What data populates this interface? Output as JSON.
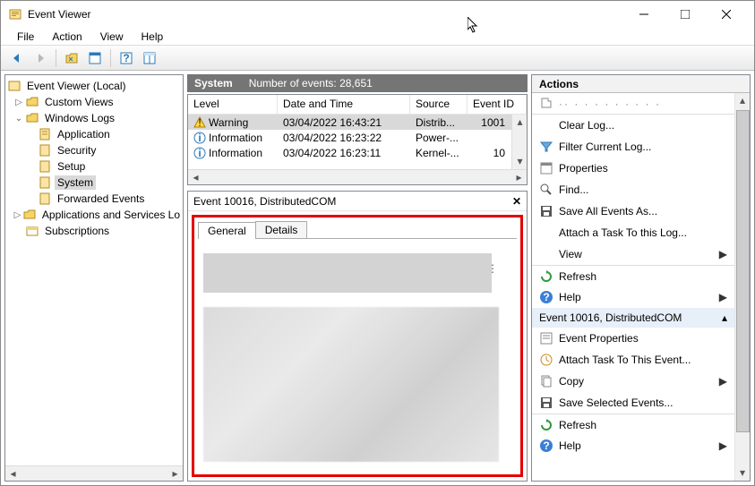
{
  "window": {
    "title": "Event Viewer"
  },
  "menu": {
    "file": "File",
    "action": "Action",
    "view": "View",
    "help": "Help"
  },
  "tree": {
    "root": "Event Viewer (Local)",
    "custom_views": "Custom Views",
    "windows_logs": "Windows Logs",
    "application": "Application",
    "security": "Security",
    "setup": "Setup",
    "system": "System",
    "forwarded": "Forwarded Events",
    "apps_services": "Applications and Services Lo",
    "subscriptions": "Subscriptions"
  },
  "center_header": {
    "title": "System",
    "count_label": "Number of events: 28,651"
  },
  "grid": {
    "cols": {
      "level": "Level",
      "dt": "Date and Time",
      "source": "Source",
      "eid": "Event ID"
    },
    "rows": [
      {
        "level": "Warning",
        "dt": "03/04/2022 16:43:21",
        "source": "Distrib...",
        "eid": "1001",
        "type": "warn"
      },
      {
        "level": "Information",
        "dt": "03/04/2022 16:23:22",
        "source": "Power-...",
        "eid": "",
        "type": "info"
      },
      {
        "level": "Information",
        "dt": "03/04/2022 16:23:11",
        "source": "Kernel-...",
        "eid": "10",
        "type": "info"
      }
    ]
  },
  "detail": {
    "title": "Event 10016, DistributedCOM",
    "tab_general": "General",
    "tab_details": "Details"
  },
  "actions": {
    "header": "Actions",
    "clear_log": "Clear Log...",
    "filter": "Filter Current Log...",
    "properties": "Properties",
    "find": "Find...",
    "save_all": "Save All Events As...",
    "attach_task": "Attach a Task To this Log...",
    "view": "View",
    "refresh": "Refresh",
    "help": "Help",
    "section2": "Event 10016, DistributedCOM",
    "event_props": "Event Properties",
    "attach_event": "Attach Task To This Event...",
    "copy": "Copy",
    "save_sel": "Save Selected Events...",
    "refresh2": "Refresh",
    "help2": "Help"
  }
}
